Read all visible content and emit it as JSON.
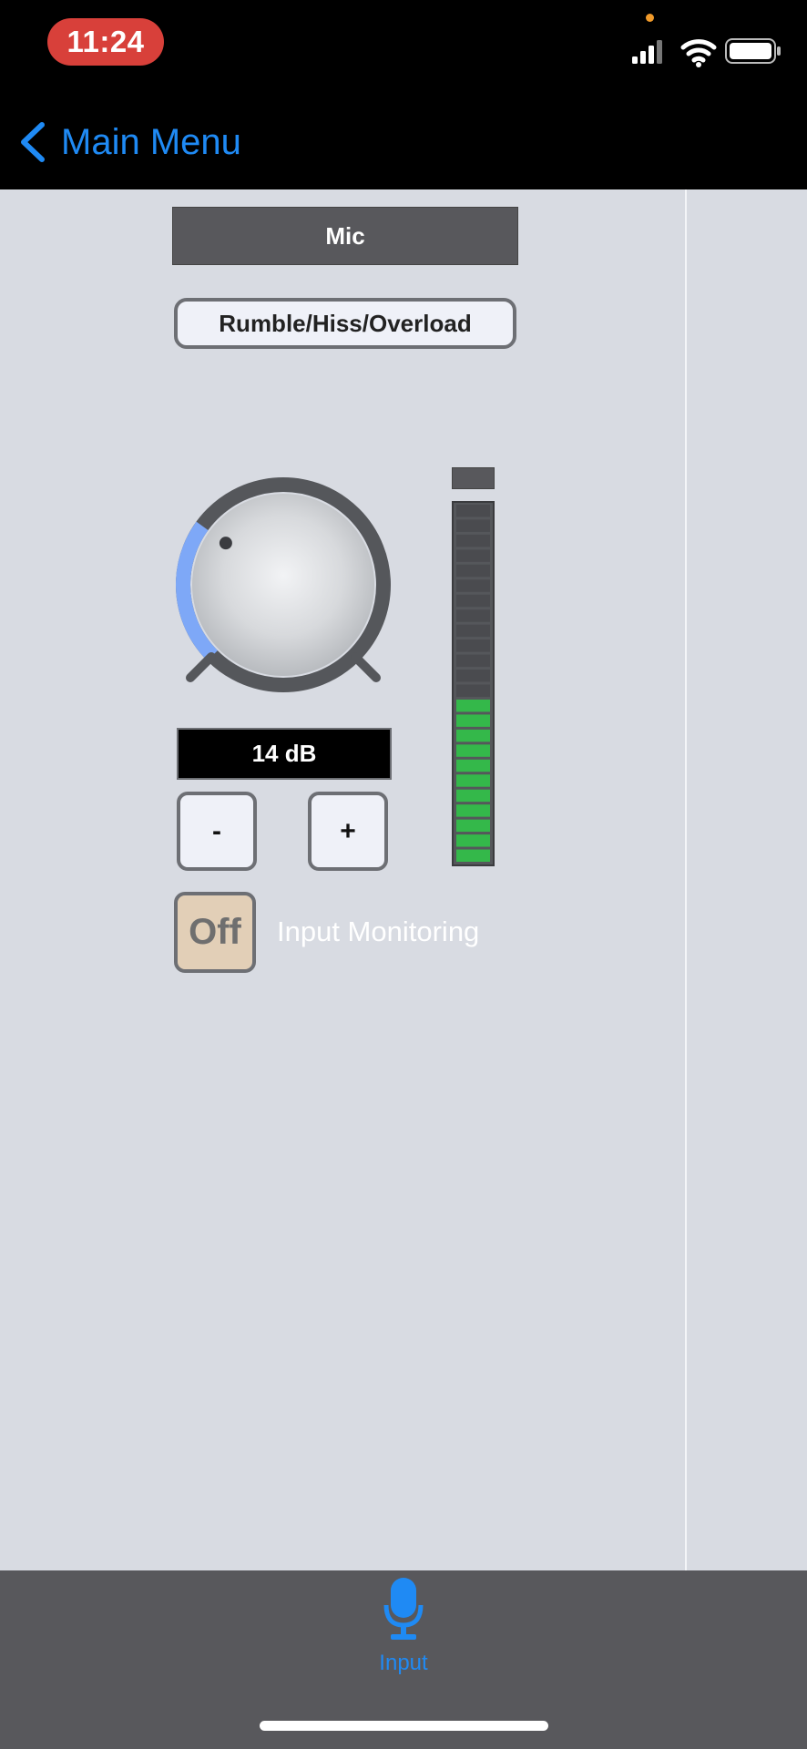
{
  "status_bar": {
    "time": "11:24",
    "icons": [
      "signal-icon",
      "wifi-icon",
      "battery-icon"
    ],
    "recording_dot_color": "#f09a2a"
  },
  "nav": {
    "back_label": "Main Menu",
    "accent_color": "#1f8af4"
  },
  "input": {
    "source_label": "Mic",
    "filter_label": "Rumble/Hiss/Overload",
    "gain_value": "14 dB",
    "gain_knob_level": 0.3,
    "decrement_label": "-",
    "increment_label": "+"
  },
  "meter": {
    "total_segments": 24,
    "lit_segments": 11,
    "lit_color": "#34b84a",
    "unlit_color": "#4a4b4f"
  },
  "monitoring": {
    "toggle_label": "Off",
    "label": "Input Monitoring"
  },
  "tab_bar": {
    "tabs": [
      {
        "label": "Input",
        "icon": "microphone-icon",
        "active": true
      }
    ]
  }
}
